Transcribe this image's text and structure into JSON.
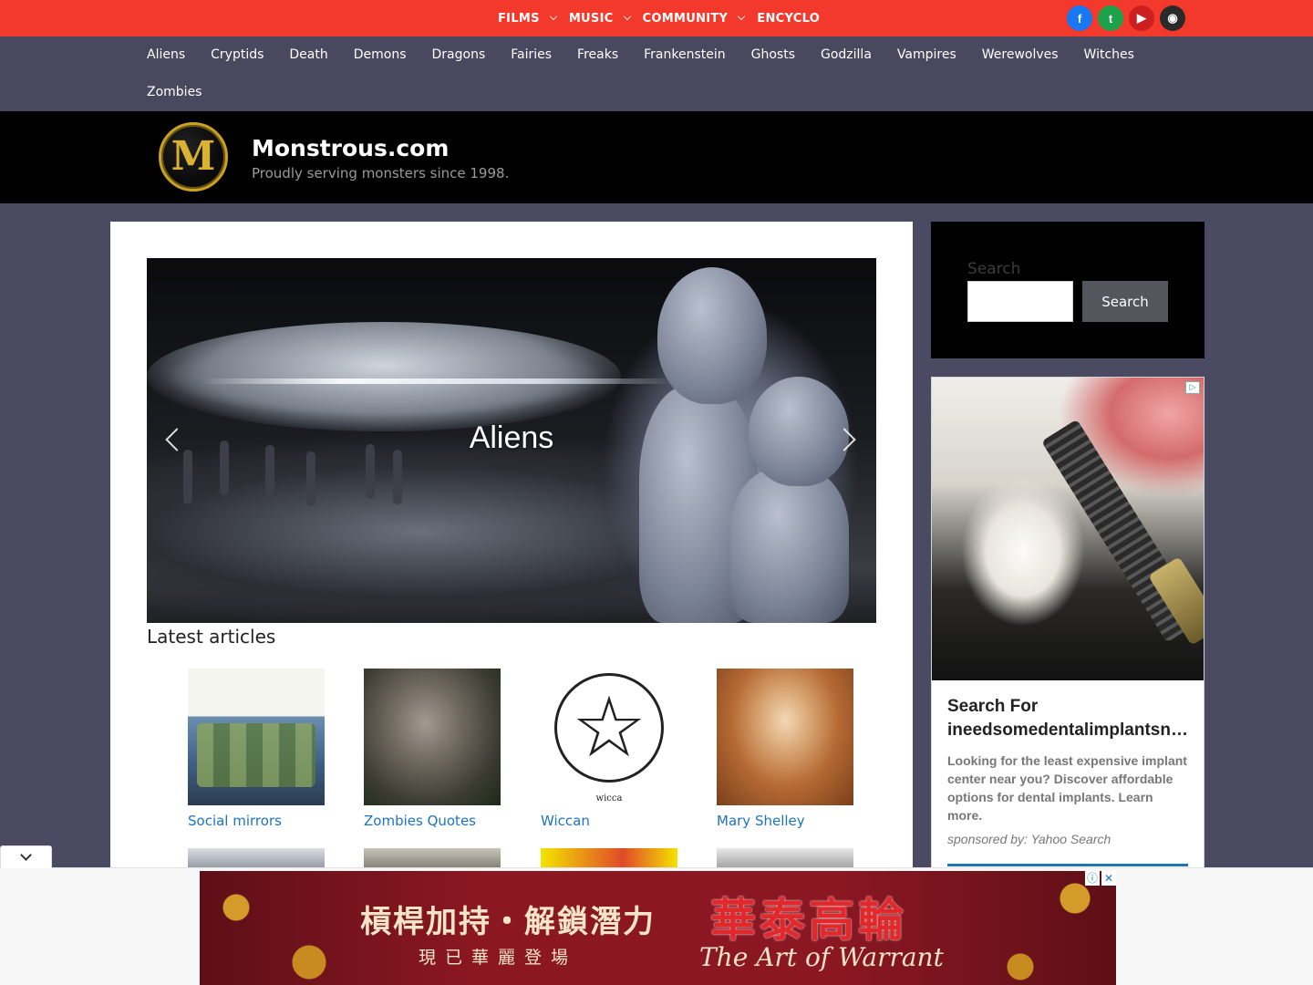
{
  "topnav": {
    "items": [
      {
        "label": "FILMS",
        "dropdown": true
      },
      {
        "label": "MUSIC",
        "dropdown": true
      },
      {
        "label": "COMMUNITY",
        "dropdown": true
      },
      {
        "label": "ENCYCLO",
        "dropdown": false
      }
    ],
    "social": [
      {
        "icon": "facebook-icon",
        "glyph": "f",
        "color": "#1877f2"
      },
      {
        "icon": "twitter-icon",
        "glyph": "t",
        "color": "#1da14a"
      },
      {
        "icon": "youtube-icon",
        "glyph": "▶",
        "color": "#cc1f1f"
      },
      {
        "icon": "discord-icon",
        "glyph": "◉",
        "color": "#2a2a2a"
      }
    ]
  },
  "categories": [
    "Aliens",
    "Cryptids",
    "Death",
    "Demons",
    "Dragons",
    "Fairies",
    "Freaks",
    "Frankenstein",
    "Ghosts",
    "Godzilla",
    "Vampires",
    "Werewolves",
    "Witches",
    "Zombies"
  ],
  "header": {
    "logo_letter": "M",
    "title": "Monstrous.com",
    "tagline": "Proudly serving monsters since 1998."
  },
  "hero": {
    "caption": "Aliens"
  },
  "latest": {
    "heading": "Latest articles",
    "articles": [
      {
        "title": "Social mirrors"
      },
      {
        "title": "Zombies Quotes"
      },
      {
        "title": "Wiccan"
      },
      {
        "title": "Mary Shelley"
      }
    ]
  },
  "wicca_image_caption": "wicca",
  "search": {
    "label": "Search",
    "placeholder": "",
    "button": "Search"
  },
  "ad": {
    "headline_1": "Search For",
    "headline_2": "ineedsomedentalimplantsn…",
    "description": "Looking for the least expensive implant center near you? Discover affordable options for dental implants. Learn more.",
    "sponsor": "sponsored by: Yahoo Search"
  },
  "banner": {
    "line1": "槓桿加持・解鎖潛力",
    "line2": "現已華麗登場",
    "brand": "華泰高輪",
    "tagline": "The Art of Warrant",
    "info_glyph": "ⓘ",
    "close_glyph": "✕"
  },
  "colors": {
    "topbar": "#f2392b",
    "nav": "#48485e",
    "page_bg": "#4a4a62",
    "link": "#1e73be"
  }
}
